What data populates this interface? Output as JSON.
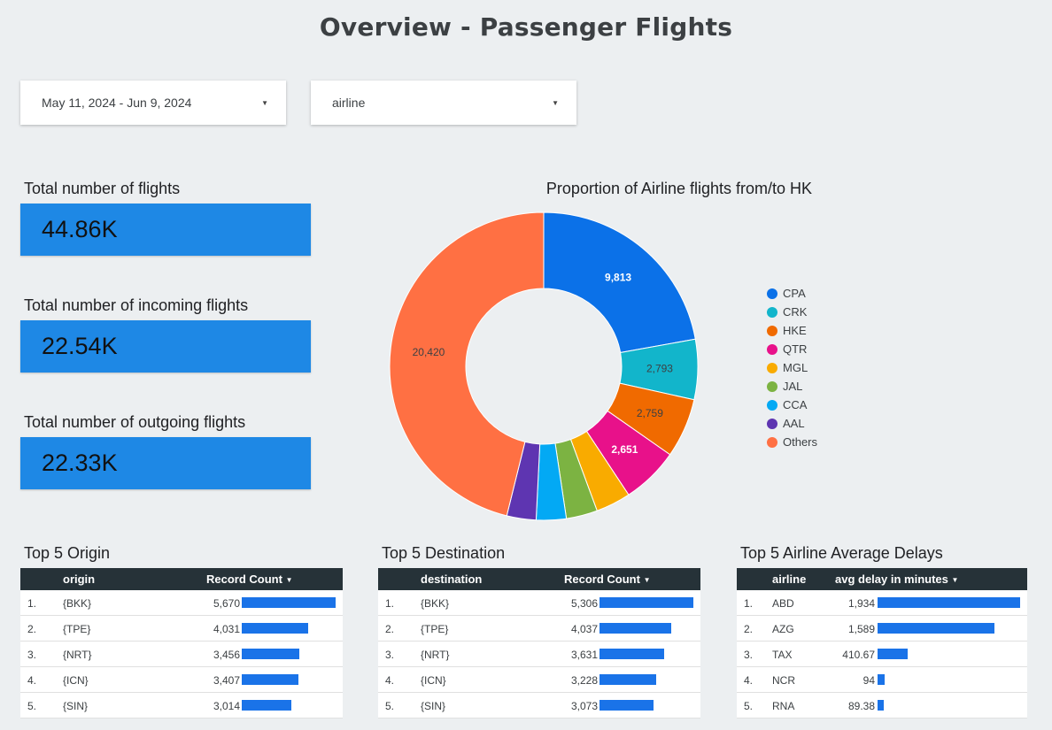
{
  "page": {
    "title": "Overview - Passenger Flights"
  },
  "filters": {
    "date_range": "May 11, 2024 - Jun 9, 2024",
    "dimension": "airline"
  },
  "kpis": [
    {
      "label": "Total number of flights",
      "value": "44.86K"
    },
    {
      "label": "Total number of incoming flights",
      "value": "22.54K"
    },
    {
      "label": "Total number of outgoing flights",
      "value": "22.33K"
    }
  ],
  "chart_data": {
    "type": "pie",
    "title": "Proportion of Airline flights from/to HK",
    "donut": true,
    "legend_position": "right",
    "slices": [
      {
        "label": "CPA",
        "value": 9813,
        "color": "#0b71e8",
        "data_label": "9,813",
        "label_color": "#ffffff"
      },
      {
        "label": "CRK",
        "value": 2793,
        "color": "#12b5cb",
        "data_label": "2,793",
        "label_color": "#3c4043"
      },
      {
        "label": "HKE",
        "value": 2759,
        "color": "#f06a00",
        "data_label": "2,759",
        "label_color": "#3c4043"
      },
      {
        "label": "QTR",
        "value": 2651,
        "color": "#e8118a",
        "data_label": "2,651",
        "label_color": "#ffffff"
      },
      {
        "label": "MGL",
        "value": 1620,
        "color": "#f9ab00",
        "data_label": "",
        "label_color": "#3c4043"
      },
      {
        "label": "JAL",
        "value": 1450,
        "color": "#7cb342",
        "data_label": "",
        "label_color": "#3c4043"
      },
      {
        "label": "CCA",
        "value": 1390,
        "color": "#03a9f4",
        "data_label": "",
        "label_color": "#3c4043"
      },
      {
        "label": "AAL",
        "value": 1360,
        "color": "#5e35b1",
        "data_label": "",
        "label_color": "#3c4043"
      },
      {
        "label": "Others",
        "value": 20420,
        "color": "#ff7043",
        "data_label": "20,420",
        "label_color": "#3c4043"
      }
    ]
  },
  "tables": [
    {
      "title": "Top 5 Origin",
      "col_dim": "origin",
      "col_metric": "Record Count",
      "sort_icon": "sort-desc-icon",
      "max": 5670,
      "rows": [
        {
          "idx": "1.",
          "name": "{BKK}",
          "value": 5670,
          "value_text": "5,670"
        },
        {
          "idx": "2.",
          "name": "{TPE}",
          "value": 4031,
          "value_text": "4,031"
        },
        {
          "idx": "3.",
          "name": "{NRT}",
          "value": 3456,
          "value_text": "3,456"
        },
        {
          "idx": "4.",
          "name": "{ICN}",
          "value": 3407,
          "value_text": "3,407"
        },
        {
          "idx": "5.",
          "name": "{SIN}",
          "value": 3014,
          "value_text": "3,014"
        }
      ]
    },
    {
      "title": "Top 5 Destination",
      "col_dim": "destination",
      "col_metric": "Record Count",
      "sort_icon": "sort-desc-icon",
      "max": 5306,
      "rows": [
        {
          "idx": "1.",
          "name": "{BKK}",
          "value": 5306,
          "value_text": "5,306"
        },
        {
          "idx": "2.",
          "name": "{TPE}",
          "value": 4037,
          "value_text": "4,037"
        },
        {
          "idx": "3.",
          "name": "{NRT}",
          "value": 3631,
          "value_text": "3,631"
        },
        {
          "idx": "4.",
          "name": "{ICN}",
          "value": 3228,
          "value_text": "3,228"
        },
        {
          "idx": "5.",
          "name": "{SIN}",
          "value": 3073,
          "value_text": "3,073"
        }
      ]
    },
    {
      "title": "Top 5 Airline Average Delays",
      "col_dim": "airline",
      "col_metric": "avg delay in minutes",
      "sort_icon": "sort-desc-icon",
      "max": 1934,
      "rows": [
        {
          "idx": "1.",
          "name": "ABD",
          "value": 1934,
          "value_text": "1,934"
        },
        {
          "idx": "2.",
          "name": "AZG",
          "value": 1589,
          "value_text": "1,589"
        },
        {
          "idx": "3.",
          "name": "TAX",
          "value": 410.67,
          "value_text": "410.67"
        },
        {
          "idx": "4.",
          "name": "NCR",
          "value": 94,
          "value_text": "94"
        },
        {
          "idx": "5.",
          "name": "RNA",
          "value": 89.38,
          "value_text": "89.38"
        }
      ]
    }
  ]
}
